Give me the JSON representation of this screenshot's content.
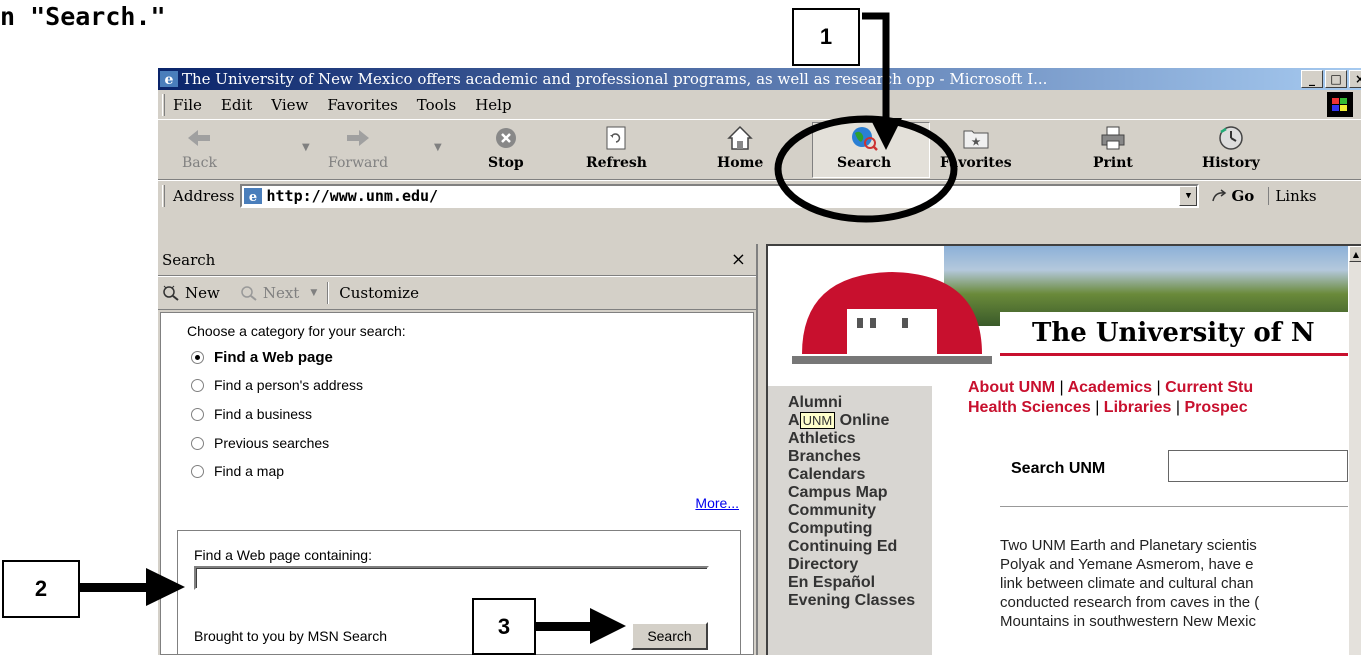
{
  "heading": "n \"Search.\"",
  "callouts": [
    "1",
    "2",
    "3"
  ],
  "window": {
    "title": "The University of New Mexico offers academic and professional programs, as well as research opp - Microsoft I...",
    "controls": [
      "_",
      "□",
      "×"
    ],
    "icon": "ie-icon"
  },
  "menu": [
    "File",
    "Edit",
    "View",
    "Favorites",
    "Tools",
    "Help"
  ],
  "toolbar": {
    "back": "Back",
    "forward": "Forward",
    "stop": "Stop",
    "refresh": "Refresh",
    "home": "Home",
    "search": "Search",
    "favorites": "Favorites",
    "print": "Print",
    "history": "History"
  },
  "address": {
    "label": "Address",
    "url": "http://www.unm.edu/",
    "go": "Go",
    "links": "Links"
  },
  "search_pane": {
    "title": "Search",
    "close": "×",
    "new_label": "New",
    "next_label": "Next",
    "customize_label": "Customize",
    "choose_text": "Choose a category for your search:",
    "categories": [
      {
        "label": "Find a Web page",
        "selected": true
      },
      {
        "label": "Find a person's address",
        "selected": false
      },
      {
        "label": "Find a business",
        "selected": false
      },
      {
        "label": "Previous searches",
        "selected": false
      },
      {
        "label": "Find a map",
        "selected": false
      }
    ],
    "more_link": "More...",
    "find_label": "Find a Web page containing:",
    "find_value": "",
    "brought_by": "Brought to you by MSN Search",
    "search_button": "Search"
  },
  "webpage": {
    "university_title": "The University of N",
    "unm_tag": "UNM",
    "nav_links": [
      "Alumni",
      "A",
      "Online",
      "Athletics",
      "Branches",
      "Calendars",
      "Campus Map",
      "Community",
      "Computing",
      "Continuing Ed",
      "Directory",
      "En Español",
      "Evening Classes"
    ],
    "top_links_row1": [
      "About UNM",
      "Academics",
      "Current Stu"
    ],
    "top_links_row2": [
      "Health Sciences",
      "Libraries",
      "Prospec"
    ],
    "pipe": "|",
    "search_label": "Search UNM",
    "news_text": "Two UNM Earth and Planetary scientis\nPolyak and Yemane Asmerom, have e\nlink between climate and cultural chan\nconducted research from caves in the (\nMountains in southwestern New Mexic"
  },
  "colors": {
    "title_gradient_start": "#0a246a",
    "title_gradient_end": "#a6caf0",
    "chrome": "#d4d0c8",
    "unm_red": "#c8102e",
    "link_blue": "#0000ee"
  }
}
